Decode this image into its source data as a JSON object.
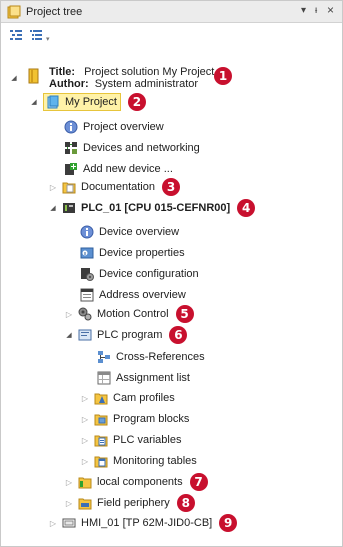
{
  "panel": {
    "title": "Project tree",
    "controls": {
      "dropdown": "▾",
      "pin": "ᵻ",
      "close": "×"
    }
  },
  "root": {
    "title_label": "Title:",
    "title_value": "Project solution My Project",
    "author_label": "Author:",
    "author_value": "System administrator",
    "callout": "1"
  },
  "tree": {
    "my_project": {
      "label": "My Project",
      "callout": "2"
    },
    "project_overview": {
      "label": "Project overview"
    },
    "devices_networking": {
      "label": "Devices and networking"
    },
    "add_device": {
      "label": "Add new device ..."
    },
    "documentation": {
      "label": "Documentation",
      "callout": "3"
    },
    "plc": {
      "label": "PLC_01 [CPU 015-CEFNR00]",
      "callout": "4"
    },
    "device_overview": {
      "label": "Device overview"
    },
    "device_properties": {
      "label": "Device properties"
    },
    "device_configuration": {
      "label": "Device configuration"
    },
    "address_overview": {
      "label": "Address overview"
    },
    "motion_control": {
      "label": "Motion Control",
      "callout": "5"
    },
    "plc_program": {
      "label": "PLC program",
      "callout": "6"
    },
    "cross_references": {
      "label": "Cross-References"
    },
    "assignment_list": {
      "label": "Assignment list"
    },
    "cam_profiles": {
      "label": "Cam profiles"
    },
    "program_blocks": {
      "label": "Program blocks"
    },
    "plc_variables": {
      "label": "PLC variables"
    },
    "monitoring_tables": {
      "label": "Monitoring tables"
    },
    "local_components": {
      "label": "local components",
      "callout": "7"
    },
    "field_periphery": {
      "label": "Field periphery",
      "callout": "8"
    },
    "hmi": {
      "label": "HMI_01 [TP 62M-JID0-CB]",
      "callout": "9"
    }
  },
  "colors": {
    "callout": "#c8102e",
    "selection_fill": "#fff2a8",
    "selection_border": "#e7c53c",
    "folder": "#f0b71a"
  }
}
